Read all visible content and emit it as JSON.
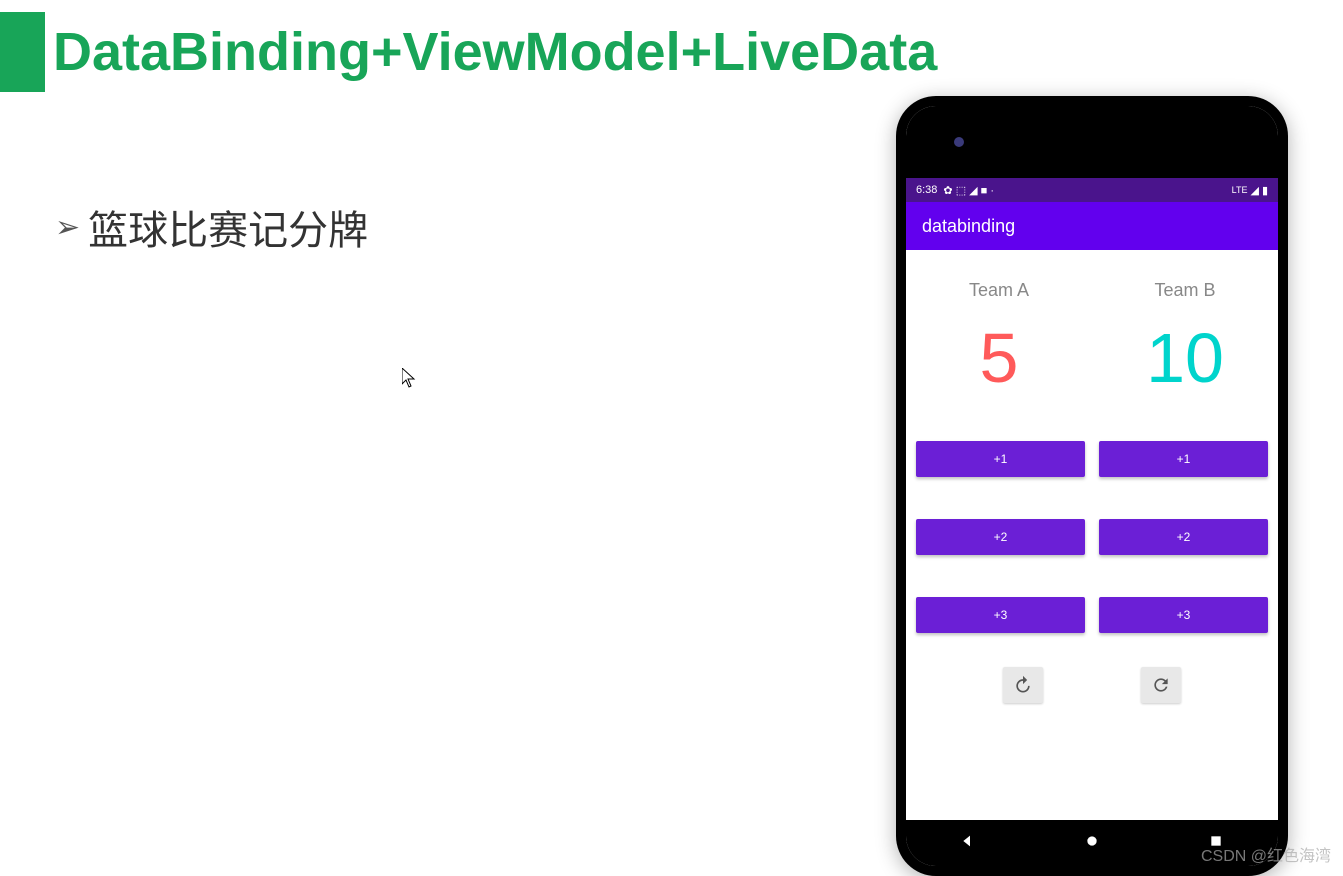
{
  "slide": {
    "title": "DataBinding+ViewModel+LiveData",
    "bullet": "篮球比赛记分牌"
  },
  "watermark": "CSDN @红色海湾",
  "phone": {
    "status": {
      "time": "6:38",
      "signal": "LTE"
    },
    "app_title": "databinding",
    "team_a": {
      "label": "Team A",
      "score": "5",
      "btn_plus1": "+1",
      "btn_plus2": "+2",
      "btn_plus3": "+3"
    },
    "team_b": {
      "label": "Team B",
      "score": "10",
      "btn_plus1": "+1",
      "btn_plus2": "+2",
      "btn_plus3": "+3"
    }
  }
}
